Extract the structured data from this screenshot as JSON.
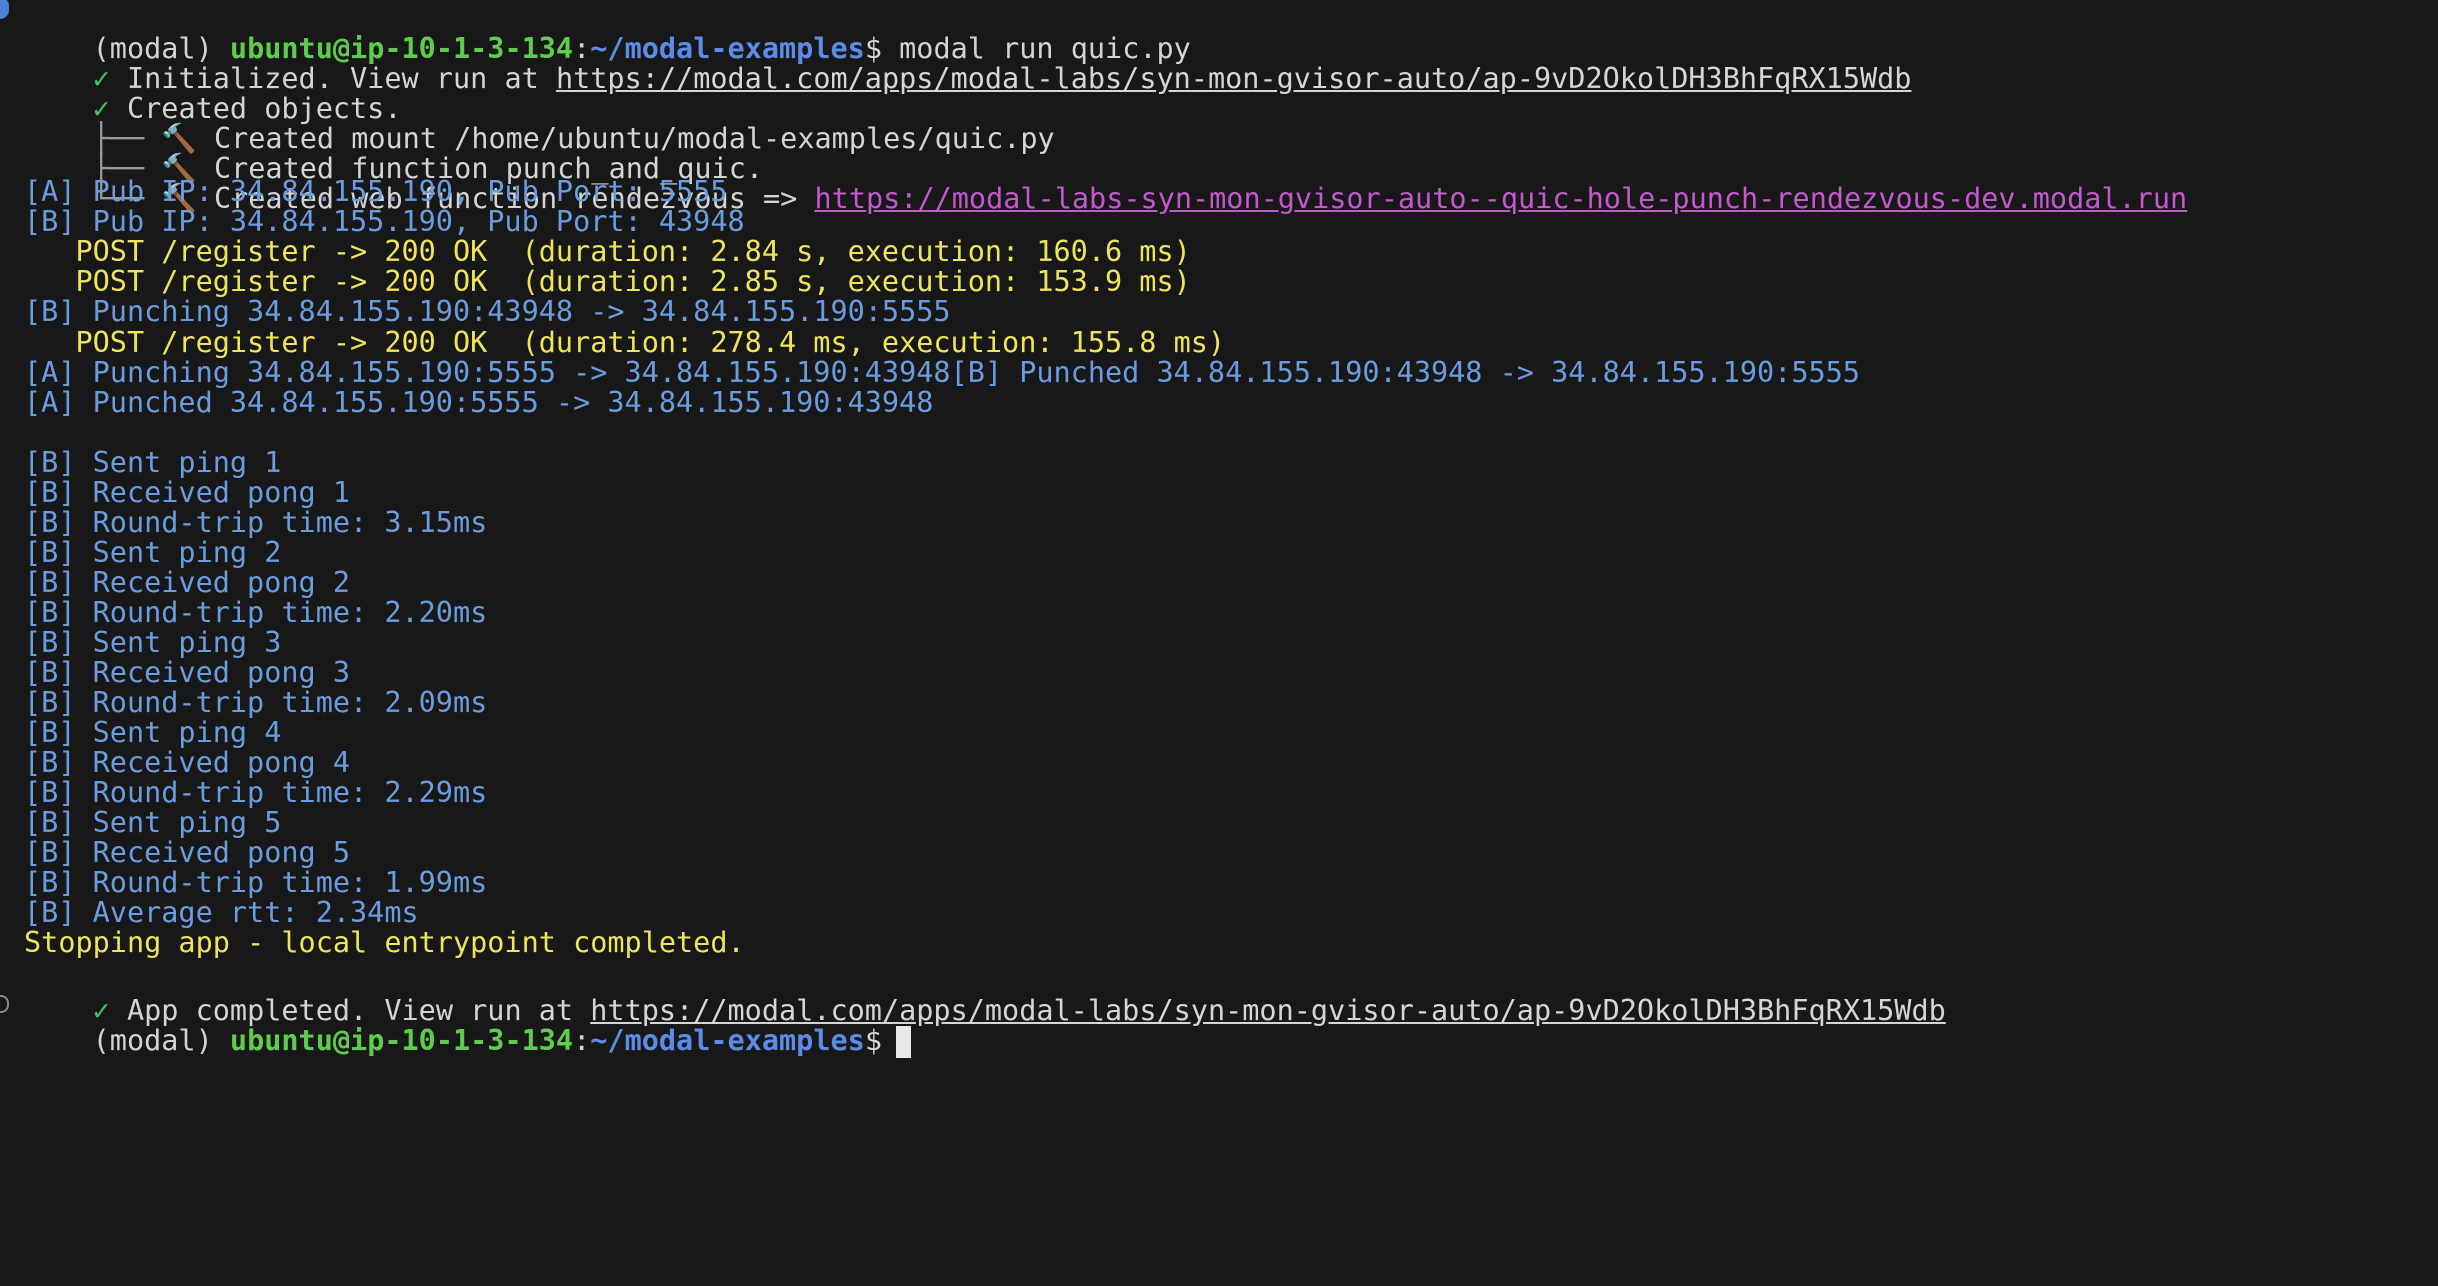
{
  "prompt": {
    "env": "(modal) ",
    "user_host": "ubuntu@ip-10-1-3-134",
    "colon": ":",
    "path": "~/modal-examples",
    "dollar": "$ ",
    "command": "modal run quic.py"
  },
  "init": {
    "check": "✓ ",
    "text": "Initialized. View run at ",
    "url": "https://modal.com/apps/modal-labs/syn-mon-gvisor-auto/ap-9vD2OkolDH3BhFqRX15Wdb"
  },
  "created": {
    "check": "✓ ",
    "text": "Created objects."
  },
  "tree": [
    {
      "branch": "├── ",
      "icon": "🔨",
      "text": " Created mount /home/ubuntu/modal-examples/quic.py",
      "url": ""
    },
    {
      "branch": "├── ",
      "icon": "🔨",
      "text": " Created function punch_and_quic.",
      "url": ""
    },
    {
      "branch": "└── ",
      "icon": "🔨",
      "text": " Created web function rendezvous => ",
      "url": "https://modal-labs-syn-mon-gvisor-auto--quic-hole-punch-rendezvous-dev.modal.run"
    }
  ],
  "log": [
    {
      "color": "blue",
      "text": "[A] Pub IP: 34.84.155.190, Pub Port: 5555"
    },
    {
      "color": "blue",
      "text": "[B] Pub IP: 34.84.155.190, Pub Port: 43948"
    },
    {
      "color": "yellow",
      "text": "   POST /register -> 200 OK  (duration: 2.84 s, execution: 160.6 ms)"
    },
    {
      "color": "yellow",
      "text": "   POST /register -> 200 OK  (duration: 2.85 s, execution: 153.9 ms)"
    },
    {
      "color": "blue",
      "text": "[B] Punching 34.84.155.190:43948 -> 34.84.155.190:5555"
    },
    {
      "color": "yellow",
      "text": "   POST /register -> 200 OK  (duration: 278.4 ms, execution: 155.8 ms)"
    },
    {
      "color": "blue",
      "text": "[A] Punching 34.84.155.190:5555 -> 34.84.155.190:43948[B] Punched 34.84.155.190:43948 -> 34.84.155.190:5555"
    },
    {
      "color": "blue",
      "text": "[A] Punched 34.84.155.190:5555 -> 34.84.155.190:43948"
    },
    {
      "color": "blank",
      "text": ""
    },
    {
      "color": "blue",
      "text": "[B] Sent ping 1"
    },
    {
      "color": "blue",
      "text": "[B] Received pong 1"
    },
    {
      "color": "blue",
      "text": "[B] Round-trip time: 3.15ms"
    },
    {
      "color": "blue",
      "text": "[B] Sent ping 2"
    },
    {
      "color": "blue",
      "text": "[B] Received pong 2"
    },
    {
      "color": "blue",
      "text": "[B] Round-trip time: 2.20ms"
    },
    {
      "color": "blue",
      "text": "[B] Sent ping 3"
    },
    {
      "color": "blue",
      "text": "[B] Received pong 3"
    },
    {
      "color": "blue",
      "text": "[B] Round-trip time: 2.09ms"
    },
    {
      "color": "blue",
      "text": "[B] Sent ping 4"
    },
    {
      "color": "blue",
      "text": "[B] Received pong 4"
    },
    {
      "color": "blue",
      "text": "[B] Round-trip time: 2.29ms"
    },
    {
      "color": "blue",
      "text": "[B] Sent ping 5"
    },
    {
      "color": "blue",
      "text": "[B] Received pong 5"
    },
    {
      "color": "blue",
      "text": "[B] Round-trip time: 1.99ms"
    },
    {
      "color": "blue",
      "text": "[B] Average rtt: 2.34ms"
    }
  ],
  "stopping": "Stopping app - local entrypoint completed.",
  "completed": {
    "check": "✓ ",
    "text": "App completed. View run at ",
    "url": "https://modal.com/apps/modal-labs/syn-mon-gvisor-auto/ap-9vD2OkolDH3BhFqRX15Wdb"
  },
  "final_prompt": {
    "env": "(modal) ",
    "user_host": "ubuntu@ip-10-1-3-134",
    "colon": ":",
    "path": "~/modal-examples",
    "dollar": "$"
  },
  "colors": {
    "background": "#181818",
    "text": "#d4d4d4",
    "success_green": "#3fc25f",
    "prompt_green": "#5fcc4e",
    "path_blue": "#5b8de8",
    "log_blue": "#6a9de0",
    "http_yellow": "#efe55a",
    "link_magenta": "#c458cf"
  }
}
